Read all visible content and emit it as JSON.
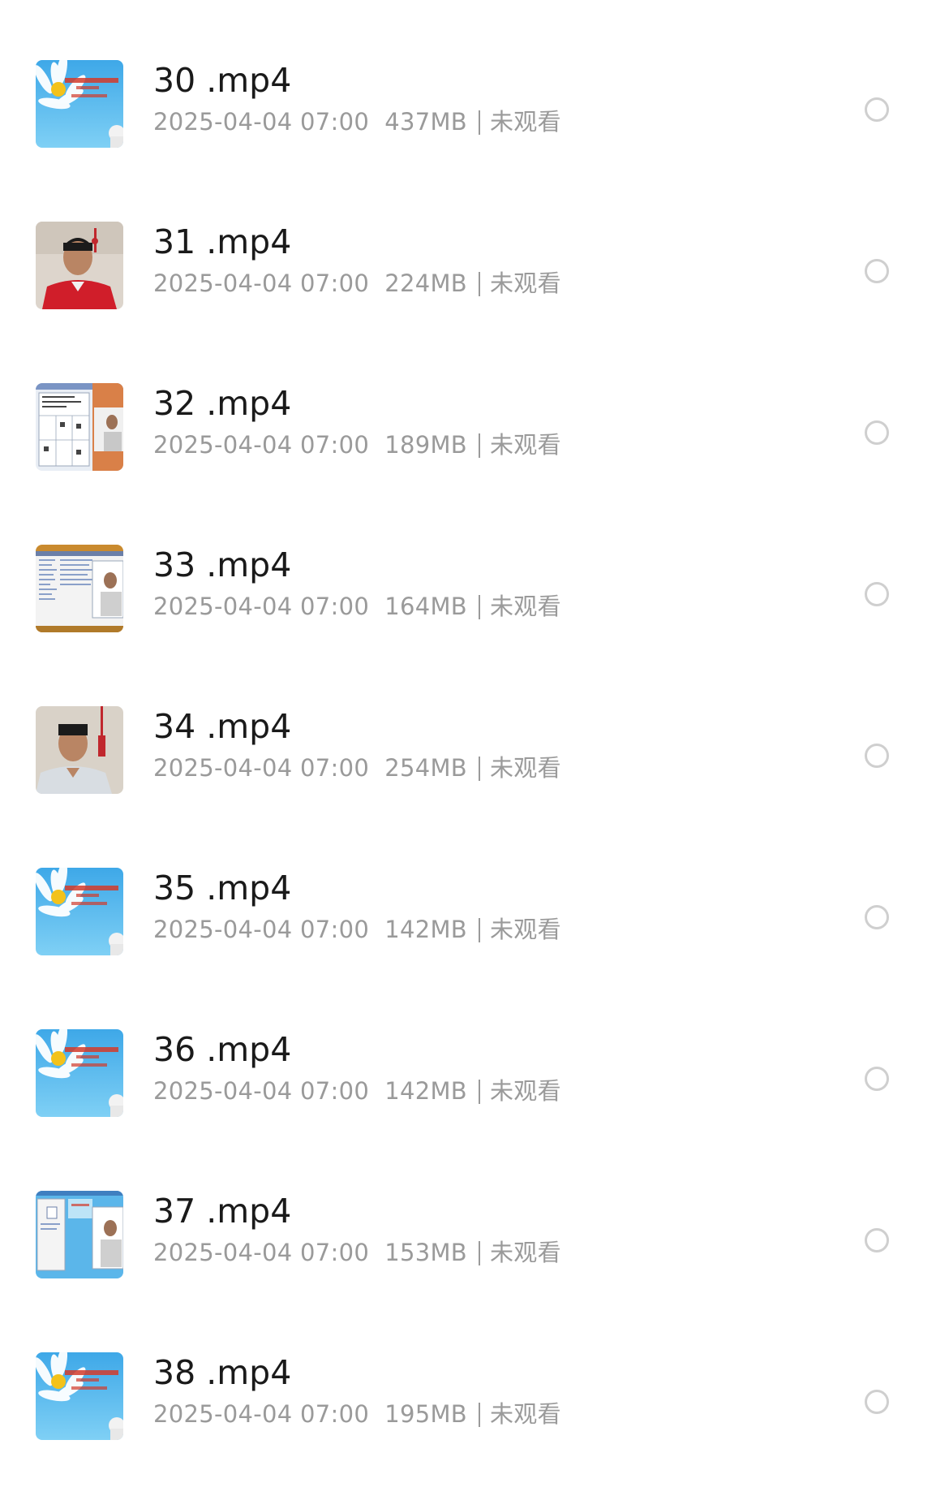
{
  "files": [
    {
      "name": "30 .mp4",
      "date": "2025-04-04 07:00",
      "size": "437MB",
      "status": "未观看",
      "thumb": "daisy-title-card"
    },
    {
      "name": "31 .mp4",
      "date": "2025-04-04 07:00",
      "size": "224MB",
      "status": "未观看",
      "thumb": "speaker-red-shirt"
    },
    {
      "name": "32 .mp4",
      "date": "2025-04-04 07:00",
      "size": "189MB",
      "status": "未观看",
      "thumb": "screen-chart-with-speaker"
    },
    {
      "name": "33 .mp4",
      "date": "2025-04-04 07:00",
      "size": "164MB",
      "status": "未观看",
      "thumb": "screen-list-with-speaker"
    },
    {
      "name": "34 .mp4",
      "date": "2025-04-04 07:00",
      "size": "254MB",
      "status": "未观看",
      "thumb": "speaker-white-shirt"
    },
    {
      "name": "35 .mp4",
      "date": "2025-04-04 07:00",
      "size": "142MB",
      "status": "未观看",
      "thumb": "daisy-title-card"
    },
    {
      "name": "36 .mp4",
      "date": "2025-04-04 07:00",
      "size": "142MB",
      "status": "未观看",
      "thumb": "daisy-title-card"
    },
    {
      "name": "37 .mp4",
      "date": "2025-04-04 07:00",
      "size": "153MB",
      "status": "未观看",
      "thumb": "screen-dialog-with-speaker"
    },
    {
      "name": "38 .mp4",
      "date": "2025-04-04 07:00",
      "size": "195MB",
      "status": "未观看",
      "thumb": "daisy-title-card"
    }
  ],
  "colors": {
    "title_text": "#1a1a1a",
    "meta_text": "#9a9a9a",
    "radio_border": "#cfcfcf",
    "background": "#ffffff"
  }
}
